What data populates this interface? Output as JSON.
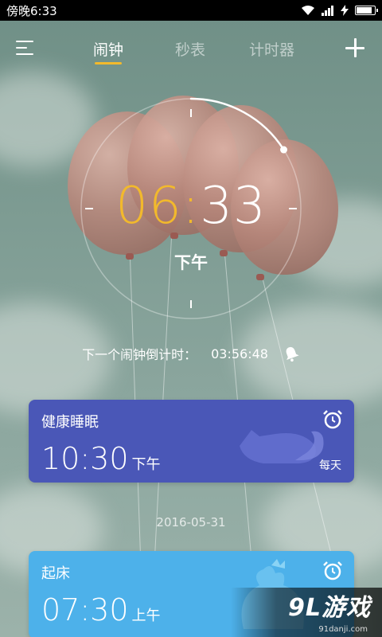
{
  "status_bar": {
    "time": "傍晚6:33",
    "icons": [
      "wifi-icon",
      "signal-icon",
      "charging-icon",
      "battery-icon"
    ],
    "battery_level": 0.9
  },
  "nav": {
    "menu_icon": "menu-icon",
    "tabs": [
      {
        "label": "闹钟",
        "active": true
      },
      {
        "label": "秒表",
        "active": false
      },
      {
        "label": "计时器",
        "active": false
      }
    ],
    "add_icon": "add-icon",
    "accent_color": "#f2b92c"
  },
  "clock": {
    "hour": "06",
    "separator": ":",
    "minute": "33",
    "period": "下午",
    "progress": 0.16
  },
  "next_alarm": {
    "label": "下一个闹钟倒计时：",
    "countdown": "03:56:48",
    "icon": "bell-icon"
  },
  "alarms": [
    {
      "title": "健康睡眠",
      "time": "10:30",
      "period": "下午",
      "repeat": "每天",
      "color": "#4a57b7",
      "icon": "alarm-clock-icon",
      "art": "fox-icon"
    },
    {
      "title": "起床",
      "time": "07:30",
      "period": "上午",
      "repeat": "",
      "color": "#4db1ea",
      "icon": "alarm-clock-icon",
      "art": "rooster-icon"
    }
  ],
  "date_separator": "2016-05-31",
  "watermark": {
    "text": "9L游戏",
    "sub": "91danji.com"
  }
}
